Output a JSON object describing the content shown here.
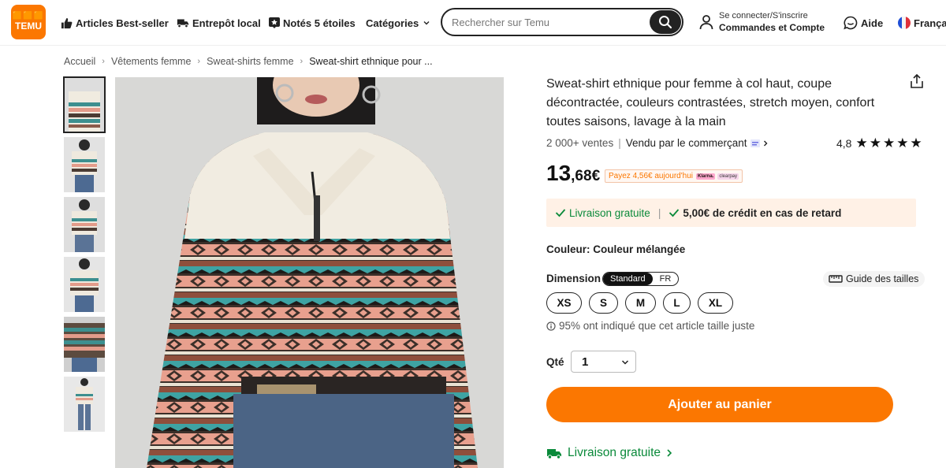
{
  "header": {
    "logo_top": "🟧🟧🟧",
    "logo_text": "TEMU",
    "nav": {
      "bestseller": "Articles Best-seller",
      "local": "Entrepôt local",
      "rated": "Notés 5 étoiles",
      "categories": "Catégories"
    },
    "search": {
      "placeholder": "Rechercher sur Temu"
    },
    "account": {
      "line1": "Se connecter/S'inscrire",
      "line2": "Commandes et Compte"
    },
    "help": "Aide",
    "language": "Français"
  },
  "breadcrumb": [
    "Accueil",
    "Vêtements femme",
    "Sweat-shirts femme",
    "Sweat-shirt ethnique pour ..."
  ],
  "product": {
    "title": "Sweat-shirt ethnique pour femme à col haut, coupe décontractée, couleurs contrastées, stretch moyen, confort toutes saisons, lavage à la main",
    "sales": "2 000+ ventes",
    "seller": "Vendu par le commerçant",
    "rating": "4,8",
    "stars": "★★★★★",
    "price_int": "13",
    "price_dec": ",68€",
    "pay_now": "Payez 4,56€ aujourd'hui",
    "klarna": "Klarna.",
    "clearpay": "clearpay",
    "promo_free": "Livraison gratuite",
    "promo_credit": "5,00€ de crédit en cas de retard",
    "color_label": "Couleur: Couleur mélangée",
    "dimension_label": "Dimension",
    "dim_standard": "Standard",
    "dim_fr": "FR",
    "size_guide": "Guide des tailles",
    "sizes": [
      "XS",
      "S",
      "M",
      "L",
      "XL"
    ],
    "fit_note": "95% ont indiqué que cet article taille juste",
    "qty_label": "Qté",
    "qty_value": "1",
    "add_to_cart": "Ajouter au panier",
    "shipping": "Livraison gratuite"
  },
  "colors": {
    "accent": "#fb7701",
    "green": "#0a8a3a",
    "promo_bg": "#fff1e6"
  },
  "icons": {
    "bestseller": "thumbs-up-icon",
    "local": "truck-icon",
    "rated": "star-badge-icon",
    "search": "search-icon",
    "account": "user-icon",
    "help": "chat-bubble-icon",
    "language": "flag-fr-icon",
    "share": "share-icon",
    "ruler": "ruler-icon",
    "info": "info-icon",
    "shipping": "truck-icon"
  }
}
